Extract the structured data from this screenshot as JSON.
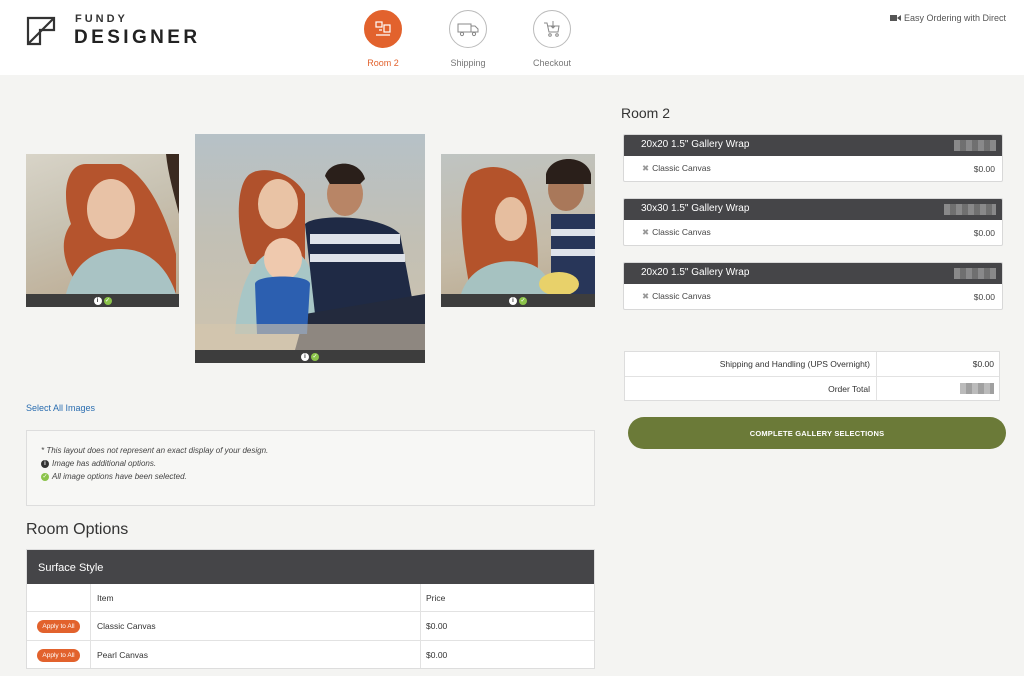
{
  "brand": {
    "line1": "FUNDY",
    "line2": "DESIGNER"
  },
  "steps": [
    {
      "label": "Room 2",
      "icon": "room-icon",
      "active": true
    },
    {
      "label": "Shipping",
      "icon": "truck-icon",
      "active": false
    },
    {
      "label": "Checkout",
      "icon": "cart-icon",
      "active": false
    }
  ],
  "easy_ordering": "Easy Ordering with Direct",
  "select_all": "Select All Images",
  "legend": {
    "note": "* This layout does not represent an exact display of your design.",
    "info": "Image has additional options.",
    "check": "All image options have been selected."
  },
  "room_options": {
    "title": "Room Options",
    "surface_title": "Surface Style",
    "col_item": "Item",
    "col_price": "Price",
    "rows": [
      {
        "button": "Apply to All",
        "item": "Classic Canvas",
        "price": "$0.00"
      },
      {
        "button": "Apply to All",
        "item": "Pearl Canvas",
        "price": "$0.00"
      }
    ]
  },
  "room": {
    "title": "Room 2",
    "products": [
      {
        "name": "20x20 1.5\" Gallery Wrap",
        "option": "Classic Canvas",
        "price": "$0.00"
      },
      {
        "name": "30x30 1.5\" Gallery Wrap",
        "option": "Classic Canvas",
        "price": "$0.00"
      },
      {
        "name": "20x20 1.5\" Gallery Wrap",
        "option": "Classic Canvas",
        "price": "$0.00"
      }
    ]
  },
  "totals": {
    "shipping_label": "Shipping and Handling (UPS Overnight)",
    "shipping_value": "$0.00",
    "order_total_label": "Order Total"
  },
  "complete_button": "COMPLETE GALLERY SELECTIONS",
  "colors": {
    "accent": "#e2622d",
    "complete": "#6b7a38",
    "dark_bar": "#454548"
  }
}
